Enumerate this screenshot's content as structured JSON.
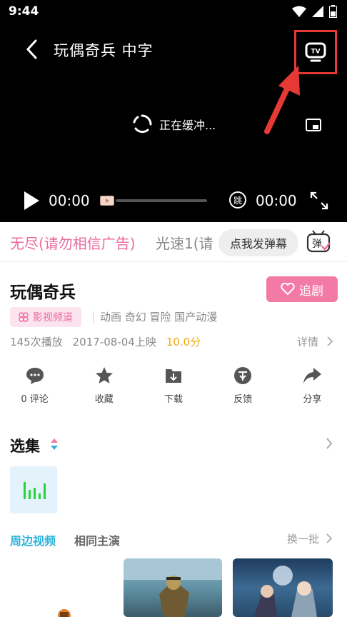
{
  "status": {
    "time": "9:44"
  },
  "player": {
    "title": "玩偶奇兵  中字",
    "buffering_text": "正在缓冲...",
    "current_time": "00:00",
    "total_time": "00:00",
    "skip_label": "跳"
  },
  "sources": {
    "active": "无尽(请勿相信广告)",
    "other": "光速1(请",
    "danmu_label": "点我发弹幕",
    "danmu_icon_label": "弹"
  },
  "info": {
    "title": "玩偶奇兵",
    "follow_label": "追剧",
    "channel_tag": "影视频道",
    "genres": "动画 奇幻 冒险 国产动漫",
    "plays": "145次播放",
    "release": "2017-08-04上映",
    "score": "10.0分",
    "detail_label": "详情"
  },
  "actions": [
    {
      "label": "0 评论",
      "icon": "comment-icon"
    },
    {
      "label": "收藏",
      "icon": "star-icon"
    },
    {
      "label": "下载",
      "icon": "download-icon"
    },
    {
      "label": "反馈",
      "icon": "feedback-icon"
    },
    {
      "label": "分享",
      "icon": "share-icon"
    }
  ],
  "episodes": {
    "title": "选集"
  },
  "related": {
    "tab_active": "周边视频",
    "tab_other": "相同主演",
    "refresh_label": "换一批"
  },
  "colors": {
    "accent_pink": "#ec6b9c",
    "accent_blue": "#2fb3d9",
    "score": "#f0a818",
    "highlight_red": "#e53935"
  }
}
